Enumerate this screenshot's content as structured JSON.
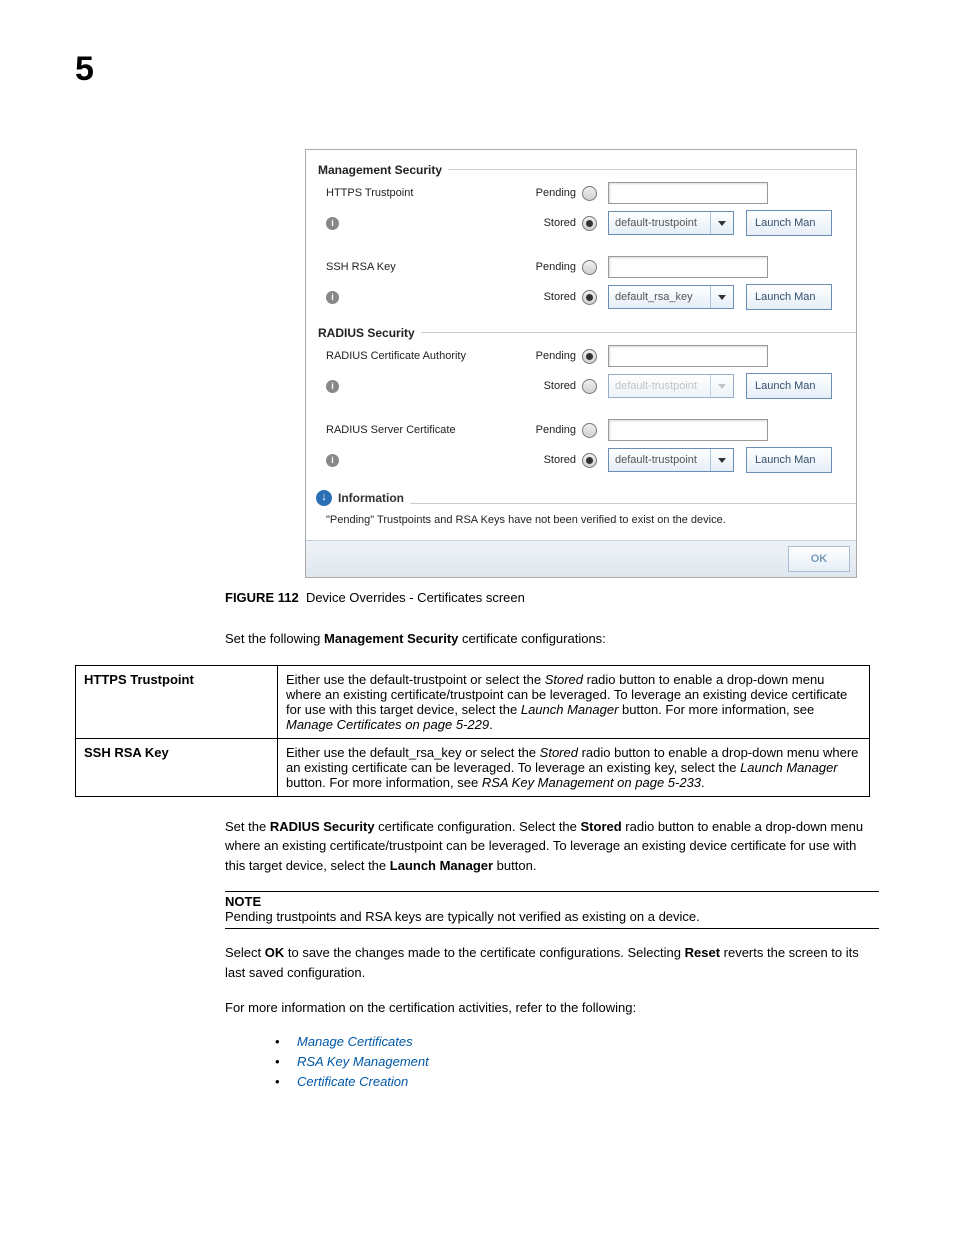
{
  "page_number": "5",
  "screenshot": {
    "mgmt_security_title": "Management Security",
    "https_trustpoint_label": "HTTPS Trustpoint",
    "ssh_rsa_key_label": "SSH RSA Key",
    "radius_security_title": "RADIUS Security",
    "radius_ca_label": "RADIUS Certificate Authority",
    "radius_server_cert_label": "RADIUS Server Certificate",
    "pending": "Pending",
    "stored": "Stored",
    "default_trustpoint": "default-trustpoint",
    "default_rsa_key": "default_rsa_key",
    "launch_man": "Launch Man",
    "information_title": "Information",
    "information_text": "\"Pending\" Trustpoints and RSA Keys have not been verified to exist on the device.",
    "ok": "OK"
  },
  "figure_label": "FIGURE 112",
  "figure_caption": "Device Overrides - Certificates screen",
  "intro_text_1": "Set the following ",
  "intro_text_bold": "Management Security",
  "intro_text_2": " certificate configurations:",
  "table": {
    "row1_term": "HTTPS Trustpoint",
    "row1_a": "Either use the default-trustpoint or select the ",
    "row1_stored": "Stored",
    "row1_b": " radio button to enable a drop-down menu where an existing certificate/trustpoint can be leveraged. To leverage an existing device certificate for use with this target device, select the ",
    "row1_launch": "Launch Manager",
    "row1_c": " button. For more information, see ",
    "row1_ref": "Manage Certificates on page 5-229",
    "row1_d": ".",
    "row2_term": "SSH RSA Key",
    "row2_a": "Either use the default_rsa_key or select the ",
    "row2_stored": "Stored",
    "row2_b": " radio button to enable a drop-down menu where an existing certificate can be leveraged. To leverage an existing key, select the ",
    "row2_launch": "Launch Manager",
    "row2_c": " button. For more information, see ",
    "row2_ref": "RSA Key Management on page 5-233",
    "row2_d": "."
  },
  "radius_text_1": "Set the ",
  "radius_bold1": "RADIUS Security",
  "radius_text_2": " certificate configuration. Select the ",
  "radius_bold2": "Stored",
  "radius_text_3": " radio button to enable a drop-down menu where an existing certificate/trustpoint can be leveraged. To leverage an existing device certificate for use with this target device, select the ",
  "radius_bold3": "Launch Manager",
  "radius_text_4": " button.",
  "note_label": "NOTE",
  "note_text": "Pending trustpoints and RSA keys are typically not verified as existing on a device.",
  "ok_text_1": "Select ",
  "ok_bold1": "OK",
  "ok_text_2": " to save the changes made to the certificate configurations. Selecting ",
  "ok_bold2": "Reset",
  "ok_text_3": " reverts the screen to its last saved configuration.",
  "more_info_text": "For more information on the certification activities, refer to the following:",
  "bullets": {
    "b1": "Manage Certificates",
    "b2": "RSA Key Management",
    "b3": "Certificate Creation"
  }
}
